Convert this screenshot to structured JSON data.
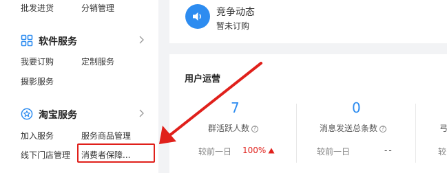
{
  "sidebar": {
    "top_items": [
      "批发进货",
      "分销管理"
    ],
    "software": {
      "title": "软件服务",
      "items": [
        "我要订购",
        "定制服务",
        "摄影服务"
      ]
    },
    "taobao": {
      "title": "淘宝服务",
      "items": [
        "加入服务",
        "服务商品管理",
        "线下门店管理",
        "消费者保障..."
      ]
    }
  },
  "competition": {
    "title": "竞争动态",
    "subtitle": "暂未订购"
  },
  "operations": {
    "title": "用户运营",
    "metrics": [
      {
        "value": "7",
        "label": "群活跃人数",
        "compare_label": "较前一日",
        "compare_value": "100%",
        "trend": "up"
      },
      {
        "value": "0",
        "label": "消息发送总条数",
        "compare_label": "较前一日",
        "compare_value": "--"
      }
    ],
    "third_partial": {
      "value_char": "",
      "label_char": "弓",
      "compare_char": "较"
    }
  },
  "colors": {
    "accent": "#2d8cf0",
    "highlight": "#e0201b"
  },
  "icons": [
    "grid-icon",
    "star-badge-icon",
    "chevron-right-icon",
    "speaker-icon",
    "help-icon",
    "arrow-up-icon"
  ]
}
